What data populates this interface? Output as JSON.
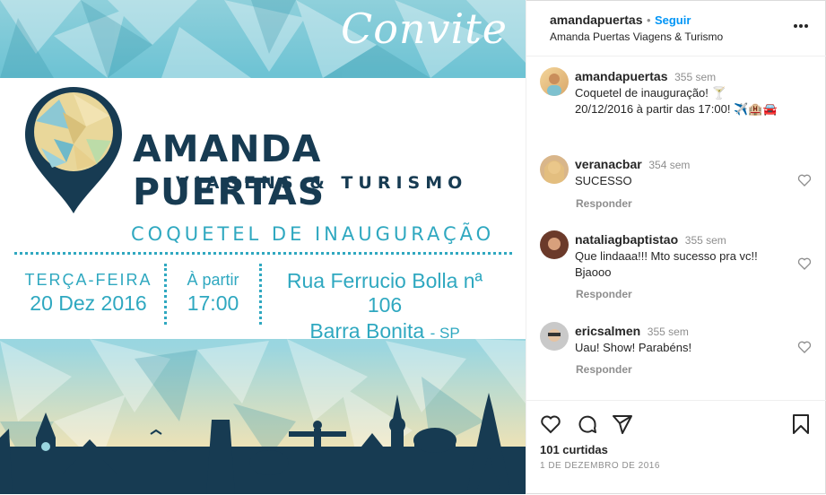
{
  "invite": {
    "convite": "Convite",
    "brand": "AMANDA PUERTAS",
    "brand_sub": "VIAGENS & TURISMO",
    "event_title": "COQUETEL DE INAUGURAÇÃO",
    "day_label": "TERÇA-FEIRA",
    "date": "20 Dez 2016",
    "time_label": "À partir",
    "time": "17:00",
    "address": "Rua Ferrucio Bolla nª 106",
    "city": "Barra Bonita",
    "state": "- SP"
  },
  "header": {
    "username": "amandapuertas",
    "separator": "•",
    "follow": "Seguir",
    "subtitle": "Amanda Puertas Viagens & Turismo",
    "more_icon": "more-horizontal-icon"
  },
  "caption": {
    "username": "amandapuertas",
    "time": "355 sem",
    "line1": "Coquetel de inauguração! 🍸",
    "line2": "20/12/2016 à partir das 17:00! ✈️🏨🚘"
  },
  "comments": [
    {
      "username": "veranacbar",
      "time": "354 sem",
      "text": "SUCESSO",
      "reply": "Responder"
    },
    {
      "username": "nataliagbaptistao",
      "time": "355 sem",
      "text": "Que lindaaa!!! Mto sucesso pra vc!! Bjaooo",
      "reply": "Responder"
    },
    {
      "username": "ericsalmen",
      "time": "355 sem",
      "text": "Uau! Show! Parabéns!",
      "reply": "Responder"
    }
  ],
  "footer": {
    "likes": "101 curtidas",
    "date": "1 DE DEZEMBRO DE 2016"
  },
  "colors": {
    "link": "#0095f6",
    "brand_navy": "#173b52",
    "brand_teal": "#2fa8c0"
  }
}
